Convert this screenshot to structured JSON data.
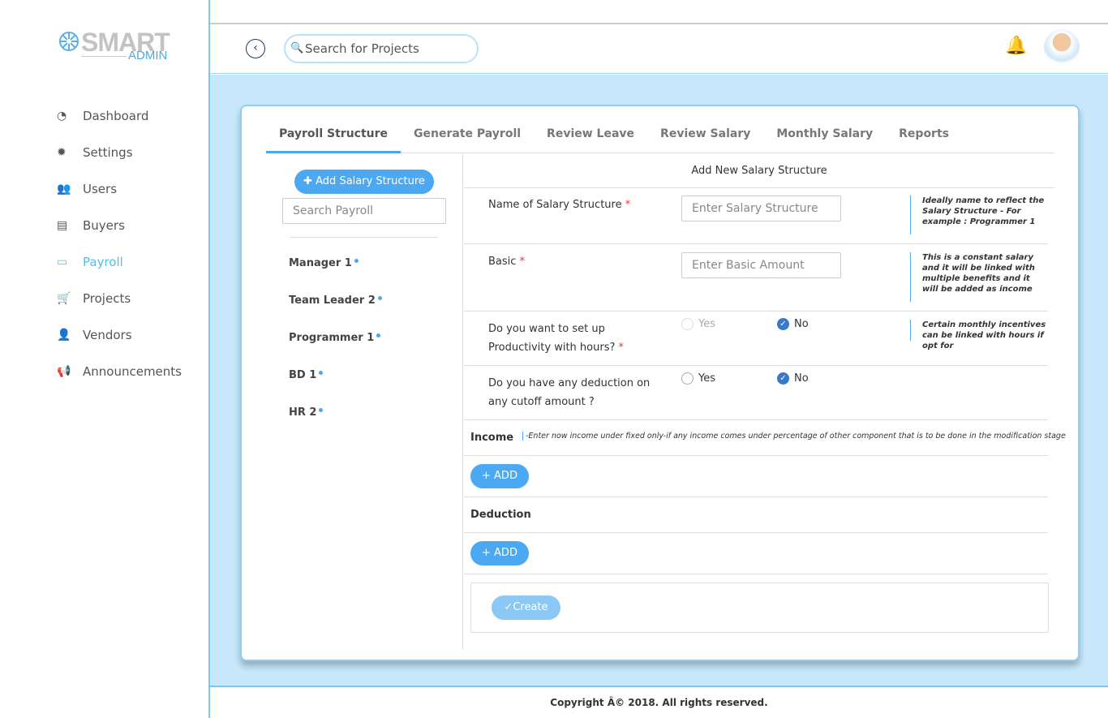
{
  "logo": {
    "smart": "SMART",
    "admin": "ADMIN"
  },
  "sidebar": {
    "items": [
      {
        "label": "Dashboard",
        "icon": "dashboard-icon",
        "glyph": "◔"
      },
      {
        "label": "Settings",
        "icon": "gear-icon",
        "glyph": "✹"
      },
      {
        "label": "Users",
        "icon": "users-icon",
        "glyph": "👥"
      },
      {
        "label": "Buyers",
        "icon": "id-card-icon",
        "glyph": "▤"
      },
      {
        "label": "Payroll",
        "icon": "credit-card-icon",
        "glyph": "▭",
        "active": true
      },
      {
        "label": "Projects",
        "icon": "cart-icon",
        "glyph": "🛒"
      },
      {
        "label": "Vendors",
        "icon": "user-plus-icon",
        "glyph": "👤"
      },
      {
        "label": "Announcements",
        "icon": "megaphone-icon",
        "glyph": "📢"
      }
    ]
  },
  "header": {
    "search_placeholder": "Search for Projects"
  },
  "tabs": [
    "Payroll Structure",
    "Generate Payroll",
    "Review Leave",
    "Review Salary",
    "Monthly Salary",
    "Reports"
  ],
  "left": {
    "add_label": "Add Salary Structure",
    "search_placeholder": "Search Payroll",
    "items": [
      "Manager 1",
      "Team Leader 2",
      "Programmer 1",
      "BD 1",
      "HR 2"
    ]
  },
  "form": {
    "title": "Add New Salary Structure",
    "name_label": "Name of Salary Structure",
    "name_placeholder": "Enter Salary Structure",
    "name_note": "Ideally name to reflect the Salary Structure - For example : Programmer 1",
    "basic_label": "Basic",
    "basic_placeholder": "Enter Basic Amount",
    "basic_note": "This is a constant salary and it will be linked with multiple benefits and it will be added as income",
    "prod_label_1": "Do you want to set up",
    "prod_label_2": "Productivity with hours?",
    "prod_note": "Certain monthly incentives can be linked with hours if opt for",
    "prod_value": "No",
    "ded_label_1": "Do you have any deduction on",
    "ded_label_2": "any cutoff amount ?",
    "ded_value": "No",
    "yes": "Yes",
    "no": "No",
    "income_label": "Income",
    "income_note": "-Enter now income under fixed only-if any income comes under percentage of other component that is to be done in the modification stage",
    "add_label": "+ ADD",
    "deduction_label": "Deduction",
    "create_label": "✓Create"
  },
  "footer": "Copyright Â© 2018. All rights reserved."
}
